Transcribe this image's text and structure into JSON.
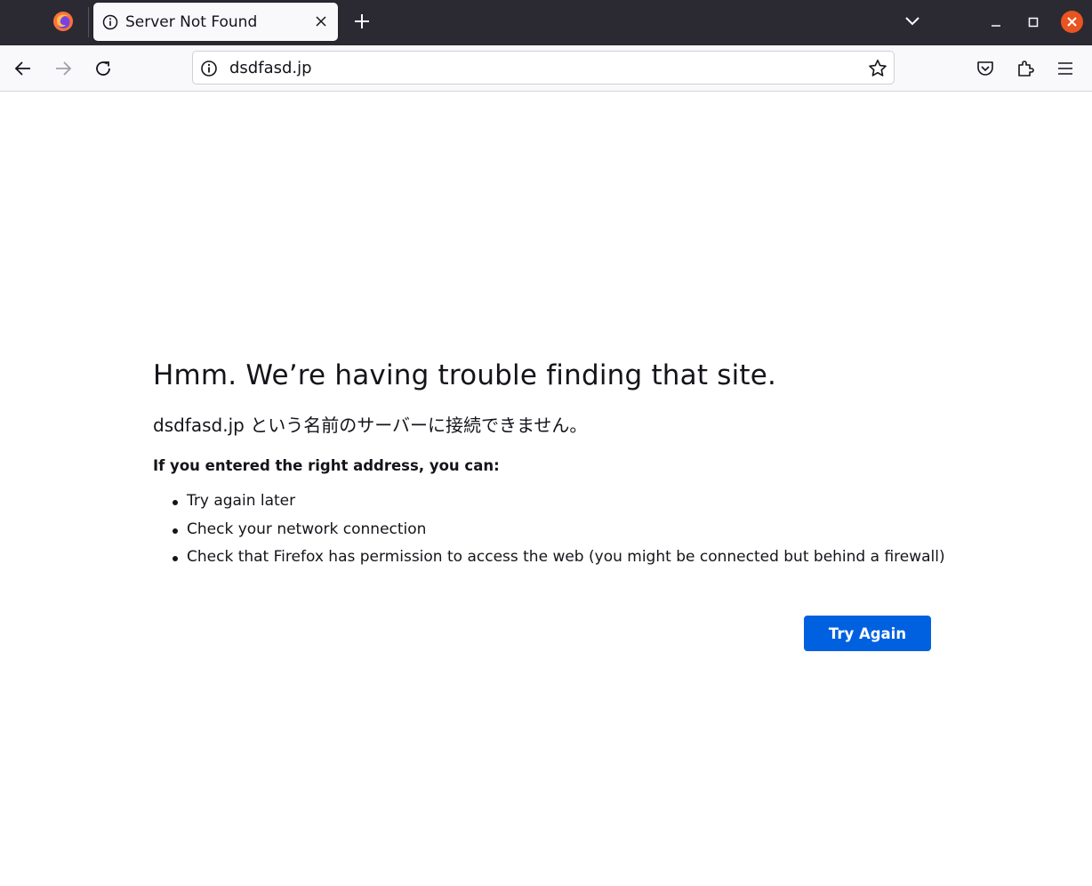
{
  "browser": {
    "tab": {
      "title": "Server Not Found"
    },
    "url": "dsdfasd.jp",
    "colors": {
      "tabstrip": "#2b2a33",
      "toolbar": "#f9f9fb",
      "close_button": "#e95420",
      "primary": "#0061e0"
    }
  },
  "error": {
    "title": "Hmm. We’re having trouble finding that site.",
    "subtitle": "dsdfasd.jp という名前のサーバーに接続できません。",
    "heading": "If you entered the right address, you can:",
    "suggestions": [
      "Try again later",
      "Check your network connection",
      "Check that Firefox has permission to access the web (you might be connected but behind a firewall)"
    ],
    "button_label": "Try Again"
  }
}
